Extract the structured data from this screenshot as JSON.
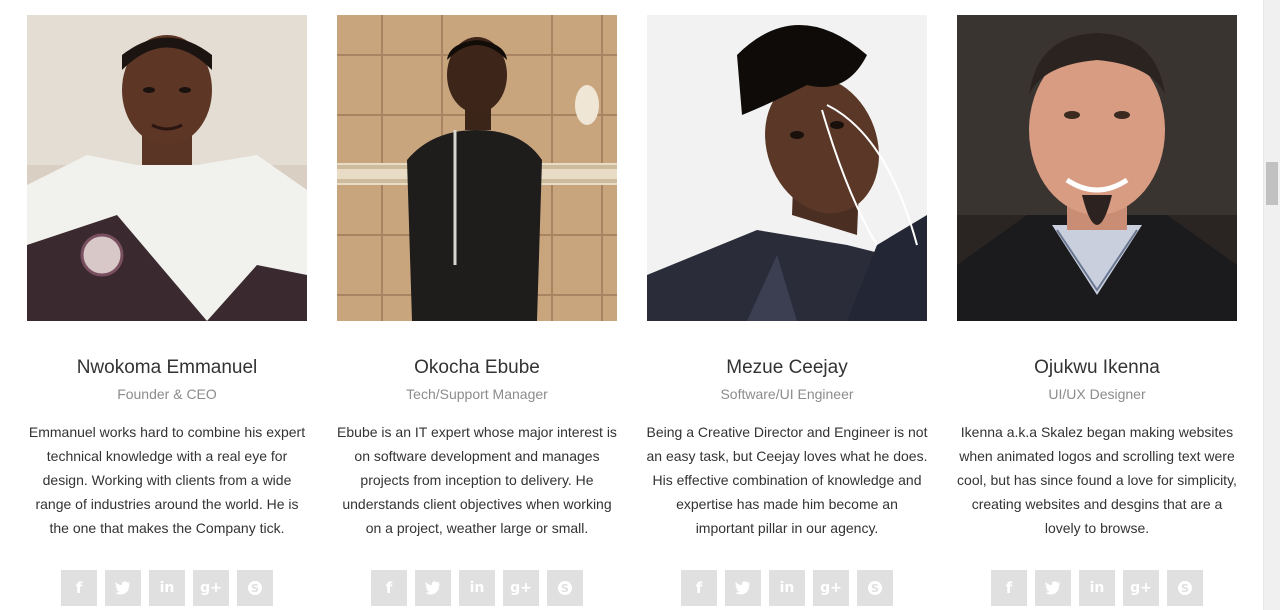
{
  "members": [
    {
      "name": "Nwokoma Emmanuel",
      "role": "Founder & CEO",
      "bio": "Emmanuel works hard to combine his expert technical knowledge with a real eye for design. Working with clients from a wide range of industries around the world. He is the one that makes the Company tick."
    },
    {
      "name": "Okocha Ebube",
      "role": "Tech/Support Manager",
      "bio": "Ebube is an IT expert whose major interest is on software development and manages projects from inception to delivery. He understands client objectives when working on a project, weather large or small."
    },
    {
      "name": "Mezue Ceejay",
      "role": "Software/UI Engineer",
      "bio": "Being a Creative Director and Engineer is not an easy task, but Ceejay loves what he does. His effective combination of knowledge and expertise has made him become an important pillar in our agency."
    },
    {
      "name": "Ojukwu Ikenna",
      "role": "UI/UX Designer",
      "bio": "Ikenna a.k.a Skalez began making websites when animated logos and scrolling text were cool, but has since found a love for simplicity, creating websites and desgins that are a lovely to browse."
    }
  ],
  "social_icons": [
    "facebook-icon",
    "twitter-icon",
    "linkedin-icon",
    "google-plus-icon",
    "skype-icon"
  ],
  "colors": {
    "social_bg": "#e0e0e0",
    "name_text": "#333333",
    "role_text": "#8c8c8c"
  }
}
